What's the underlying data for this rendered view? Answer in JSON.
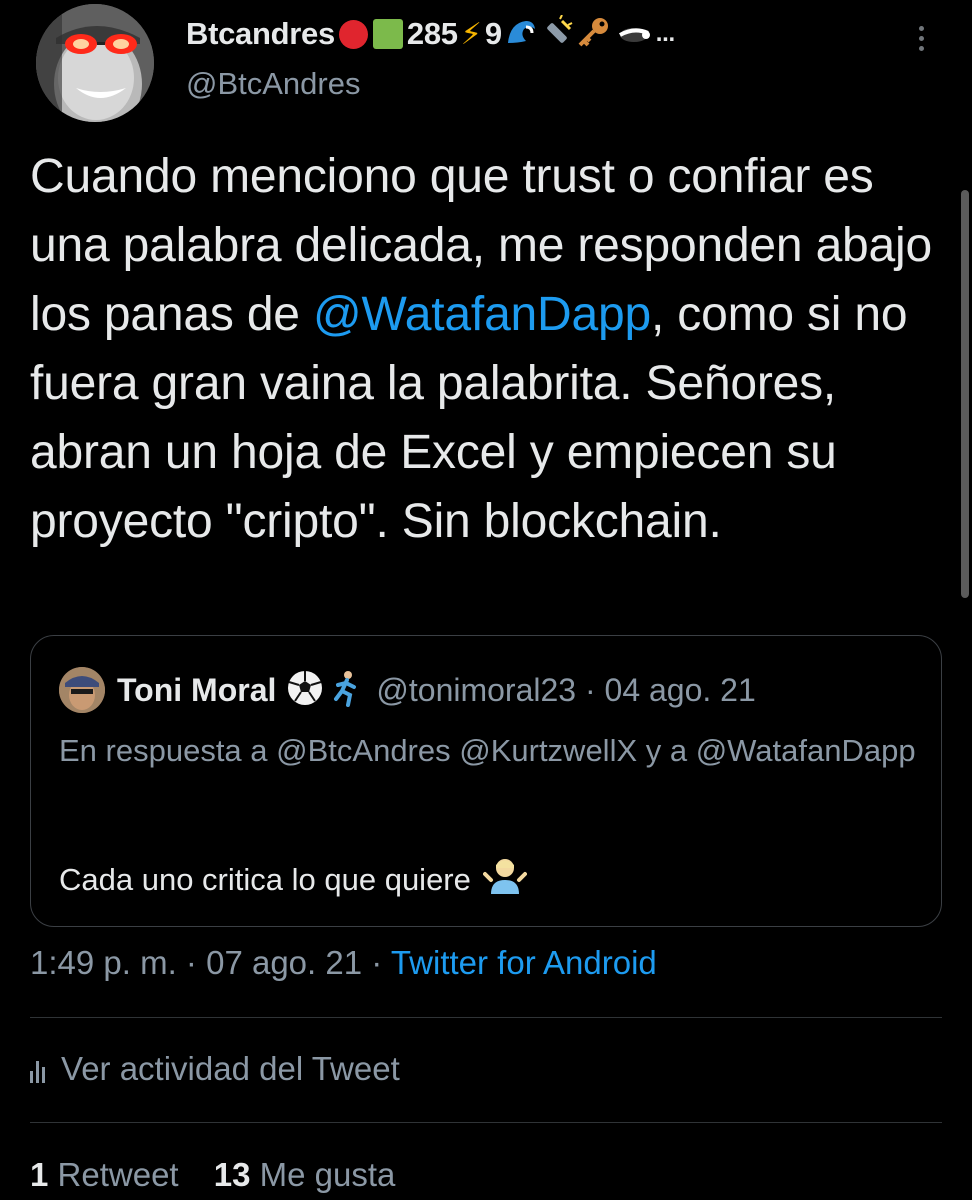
{
  "author": {
    "display_name": "Btcandres",
    "badges": [
      "red-circle",
      "green-square"
    ],
    "badge_number_1": "285",
    "badge_bolt": "⚡",
    "badge_number_2": "9",
    "badge_icons": [
      "wave-icon",
      "flashlight-icon",
      "key-icon",
      "skunk-icon"
    ],
    "ellipsis": "...",
    "handle": "@BtcAndres"
  },
  "tweet": {
    "text_1": "Cuando menciono que trust o confiar es una palabra delicada, me responden abajo los panas de ",
    "mention": "@WatafanDapp",
    "text_2": ", como si no fuera gran vaina la palabrita. Señores, abran un hoja de Excel y empiecen su proyecto \"cripto\". Sin blockchain."
  },
  "quoted_tweet": {
    "display_name": "Toni Moral",
    "name_icons": [
      "soccer-ball-icon",
      "runner-icon"
    ],
    "handle_and_date": "@tonimoral23 · 04 ago. 21",
    "reply_line": "En respuesta a @BtcAndres @KurtzwellX y a @WatafanDapp",
    "text": "Cada uno critica lo que quiere",
    "text_emoji": "person-shrugging-icon"
  },
  "meta": {
    "time": "1:49 p. m.",
    "date": "07 ago. 21",
    "separator": "·",
    "source": "Twitter for Android"
  },
  "activity": {
    "label": "Ver actividad del Tweet"
  },
  "stats": {
    "retweets_count": "1",
    "retweets_label": "Retweet",
    "likes_count": "13",
    "likes_label": "Me gusta"
  },
  "colors": {
    "background": "#000000",
    "text": "#e7e9ea",
    "secondary": "#8b98a5",
    "accent": "#1d9bf0",
    "border": "#3b3f44"
  }
}
